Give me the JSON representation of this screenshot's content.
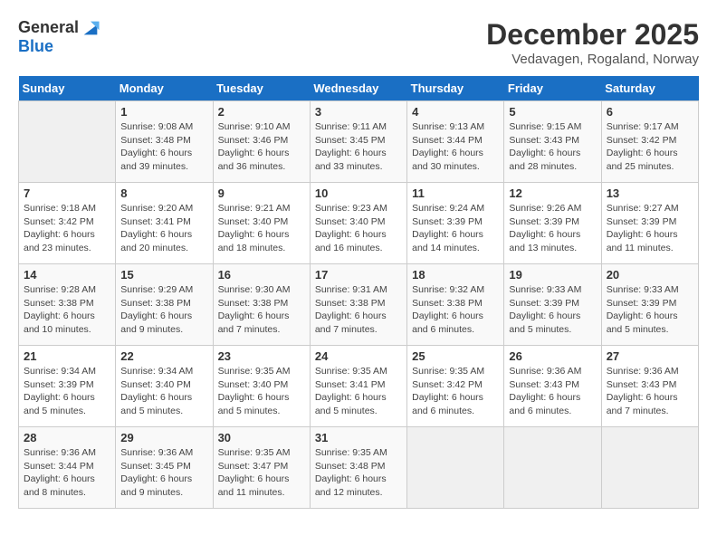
{
  "logo": {
    "general": "General",
    "blue": "Blue"
  },
  "title": "December 2025",
  "location": "Vedavagen, Rogaland, Norway",
  "days_of_week": [
    "Sunday",
    "Monday",
    "Tuesday",
    "Wednesday",
    "Thursday",
    "Friday",
    "Saturday"
  ],
  "weeks": [
    [
      {
        "day": "",
        "info": ""
      },
      {
        "day": "1",
        "info": "Sunrise: 9:08 AM\nSunset: 3:48 PM\nDaylight: 6 hours\nand 39 minutes."
      },
      {
        "day": "2",
        "info": "Sunrise: 9:10 AM\nSunset: 3:46 PM\nDaylight: 6 hours\nand 36 minutes."
      },
      {
        "day": "3",
        "info": "Sunrise: 9:11 AM\nSunset: 3:45 PM\nDaylight: 6 hours\nand 33 minutes."
      },
      {
        "day": "4",
        "info": "Sunrise: 9:13 AM\nSunset: 3:44 PM\nDaylight: 6 hours\nand 30 minutes."
      },
      {
        "day": "5",
        "info": "Sunrise: 9:15 AM\nSunset: 3:43 PM\nDaylight: 6 hours\nand 28 minutes."
      },
      {
        "day": "6",
        "info": "Sunrise: 9:17 AM\nSunset: 3:42 PM\nDaylight: 6 hours\nand 25 minutes."
      }
    ],
    [
      {
        "day": "7",
        "info": "Sunrise: 9:18 AM\nSunset: 3:42 PM\nDaylight: 6 hours\nand 23 minutes."
      },
      {
        "day": "8",
        "info": "Sunrise: 9:20 AM\nSunset: 3:41 PM\nDaylight: 6 hours\nand 20 minutes."
      },
      {
        "day": "9",
        "info": "Sunrise: 9:21 AM\nSunset: 3:40 PM\nDaylight: 6 hours\nand 18 minutes."
      },
      {
        "day": "10",
        "info": "Sunrise: 9:23 AM\nSunset: 3:40 PM\nDaylight: 6 hours\nand 16 minutes."
      },
      {
        "day": "11",
        "info": "Sunrise: 9:24 AM\nSunset: 3:39 PM\nDaylight: 6 hours\nand 14 minutes."
      },
      {
        "day": "12",
        "info": "Sunrise: 9:26 AM\nSunset: 3:39 PM\nDaylight: 6 hours\nand 13 minutes."
      },
      {
        "day": "13",
        "info": "Sunrise: 9:27 AM\nSunset: 3:39 PM\nDaylight: 6 hours\nand 11 minutes."
      }
    ],
    [
      {
        "day": "14",
        "info": "Sunrise: 9:28 AM\nSunset: 3:38 PM\nDaylight: 6 hours\nand 10 minutes."
      },
      {
        "day": "15",
        "info": "Sunrise: 9:29 AM\nSunset: 3:38 PM\nDaylight: 6 hours\nand 9 minutes."
      },
      {
        "day": "16",
        "info": "Sunrise: 9:30 AM\nSunset: 3:38 PM\nDaylight: 6 hours\nand 7 minutes."
      },
      {
        "day": "17",
        "info": "Sunrise: 9:31 AM\nSunset: 3:38 PM\nDaylight: 6 hours\nand 7 minutes."
      },
      {
        "day": "18",
        "info": "Sunrise: 9:32 AM\nSunset: 3:38 PM\nDaylight: 6 hours\nand 6 minutes."
      },
      {
        "day": "19",
        "info": "Sunrise: 9:33 AM\nSunset: 3:39 PM\nDaylight: 6 hours\nand 5 minutes."
      },
      {
        "day": "20",
        "info": "Sunrise: 9:33 AM\nSunset: 3:39 PM\nDaylight: 6 hours\nand 5 minutes."
      }
    ],
    [
      {
        "day": "21",
        "info": "Sunrise: 9:34 AM\nSunset: 3:39 PM\nDaylight: 6 hours\nand 5 minutes."
      },
      {
        "day": "22",
        "info": "Sunrise: 9:34 AM\nSunset: 3:40 PM\nDaylight: 6 hours\nand 5 minutes."
      },
      {
        "day": "23",
        "info": "Sunrise: 9:35 AM\nSunset: 3:40 PM\nDaylight: 6 hours\nand 5 minutes."
      },
      {
        "day": "24",
        "info": "Sunrise: 9:35 AM\nSunset: 3:41 PM\nDaylight: 6 hours\nand 5 minutes."
      },
      {
        "day": "25",
        "info": "Sunrise: 9:35 AM\nSunset: 3:42 PM\nDaylight: 6 hours\nand 6 minutes."
      },
      {
        "day": "26",
        "info": "Sunrise: 9:36 AM\nSunset: 3:43 PM\nDaylight: 6 hours\nand 6 minutes."
      },
      {
        "day": "27",
        "info": "Sunrise: 9:36 AM\nSunset: 3:43 PM\nDaylight: 6 hours\nand 7 minutes."
      }
    ],
    [
      {
        "day": "28",
        "info": "Sunrise: 9:36 AM\nSunset: 3:44 PM\nDaylight: 6 hours\nand 8 minutes."
      },
      {
        "day": "29",
        "info": "Sunrise: 9:36 AM\nSunset: 3:45 PM\nDaylight: 6 hours\nand 9 minutes."
      },
      {
        "day": "30",
        "info": "Sunrise: 9:35 AM\nSunset: 3:47 PM\nDaylight: 6 hours\nand 11 minutes."
      },
      {
        "day": "31",
        "info": "Sunrise: 9:35 AM\nSunset: 3:48 PM\nDaylight: 6 hours\nand 12 minutes."
      },
      {
        "day": "",
        "info": ""
      },
      {
        "day": "",
        "info": ""
      },
      {
        "day": "",
        "info": ""
      }
    ]
  ]
}
